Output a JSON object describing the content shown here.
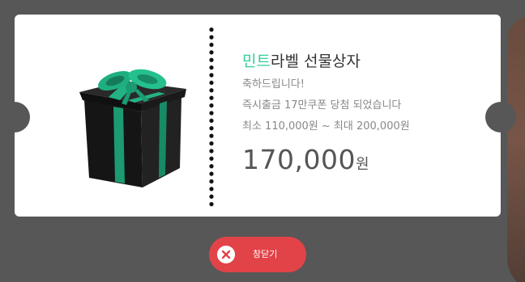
{
  "card": {
    "title_brand": "민트",
    "title_rest": "라벨 선물상자",
    "congrats": "축하드립니다!",
    "coupon_line": "즉시출금 17만쿠폰 당첨 되었습니다",
    "range_line": "최소 110,000원 ~ 최대 200,000원",
    "amount": "170,000",
    "amount_unit": "원"
  },
  "close_button": {
    "label": "창닫기"
  },
  "colors": {
    "accent": "#2fcf9a",
    "close_button": "#e24348",
    "background": "#575757"
  },
  "icons": {
    "gift": "gift-box-icon",
    "close": "close-circle-icon"
  }
}
